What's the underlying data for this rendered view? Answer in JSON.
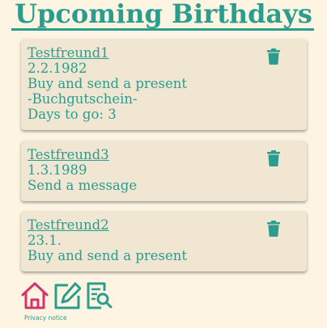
{
  "header": {
    "title": "Upcoming Birthdays"
  },
  "birthdays": [
    {
      "name": "Testfreund1",
      "date": "2.2.1982",
      "lines": [
        "Buy and send a present",
        "-Buchgutschein-",
        "Days to go: 3"
      ],
      "delete_icon": "trash-icon"
    },
    {
      "name": "Testfreund3",
      "date": "1.3.1989",
      "lines": [
        "Send a message"
      ],
      "delete_icon": "trash-icon"
    },
    {
      "name": "Testfreund2",
      "date": "23.1.",
      "lines": [
        "Buy and send a present"
      ],
      "delete_icon": "trash-icon"
    }
  ],
  "nav": {
    "items": [
      {
        "icon": "home-icon",
        "color": "#d6336c"
      },
      {
        "icon": "edit-icon",
        "color": "#2a9d8f"
      },
      {
        "icon": "search-list-icon",
        "color": "#2a9d8f"
      }
    ],
    "privacy_label": "Privacy notice"
  },
  "colors": {
    "accent": "#2a9d8f",
    "home": "#d6336c",
    "background": "#fdf5e2",
    "card": "#f0e6d2"
  }
}
